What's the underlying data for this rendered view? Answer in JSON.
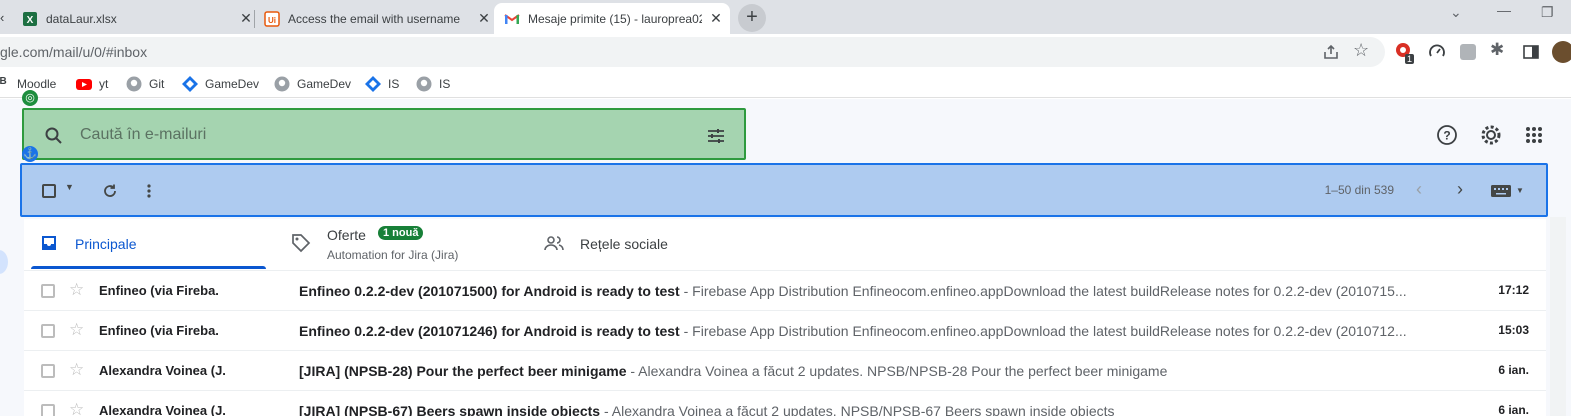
{
  "browser": {
    "tabs": [
      {
        "title": "dataLaur.xlsx",
        "favicon": "excel-icon"
      },
      {
        "title": "Access the email with username",
        "favicon": "uipath-icon"
      },
      {
        "title": "Mesaje primite (15) - lauroprea02",
        "favicon": "gmail-icon",
        "active": true
      }
    ],
    "new_tab_label": "+",
    "url": "gle.com/mail/u/0/#inbox",
    "extension_badge": "1",
    "bookmarks": [
      {
        "label": "Moodle",
        "icon": "moodle-icon"
      },
      {
        "label": "yt",
        "icon": "youtube-icon"
      },
      {
        "label": "Git",
        "icon": "github-icon"
      },
      {
        "label": "GameDev",
        "icon": "diamond-icon"
      },
      {
        "label": "GameDev",
        "icon": "github-icon"
      },
      {
        "label": "IS",
        "icon": "diamond-icon"
      },
      {
        "label": "IS",
        "icon": "github-icon"
      }
    ]
  },
  "gmail": {
    "search_placeholder": "Caută în e-mailuri",
    "pager_text": "1–50 din 539",
    "categories": [
      {
        "label": "Principale",
        "active": true
      },
      {
        "label": "Oferte",
        "badge": "1 nouă",
        "sub": "Automation for Jira (Jira)"
      },
      {
        "label": "Rețele sociale"
      }
    ],
    "emails": [
      {
        "sender": "Enfineo (via Fireba.",
        "subject": "Enfineo 0.2.2-dev (201071500) for Android is ready to test",
        "snippet": " - Firebase App Distribution Enfineocom.enfineo.appDownload the latest buildRelease notes for 0.2.2-dev (2010715...",
        "date": "17:12"
      },
      {
        "sender": "Enfineo (via Fireba.",
        "subject": "Enfineo 0.2.2-dev (201071246) for Android is ready to test",
        "snippet": " - Firebase App Distribution Enfineocom.enfineo.appDownload the latest buildRelease notes for 0.2.2-dev (2010712...",
        "date": "15:03"
      },
      {
        "sender": "Alexandra Voinea (J.",
        "subject": "[JIRA] (NPSB-28) Pour the perfect beer minigame",
        "snippet": " - Alexandra Voinea a făcut 2 updates. NPSB/NPSB-28 Pour the perfect beer minigame",
        "date": "6 ian."
      },
      {
        "sender": "Alexandra Voinea (J.",
        "subject": "[JIRA] (NPSB-67) Beers spawn inside objects",
        "snippet": " - Alexandra Voinea a făcut 2 updates. NPSB/NPSB-67 Beers spawn inside objects",
        "date": "6 ian."
      }
    ]
  },
  "colors": {
    "search_overlay": "#a5d4b0",
    "toolbar_overlay": "#aecbf0",
    "accent_blue": "#0b57d0",
    "badge_green": "#188038"
  }
}
